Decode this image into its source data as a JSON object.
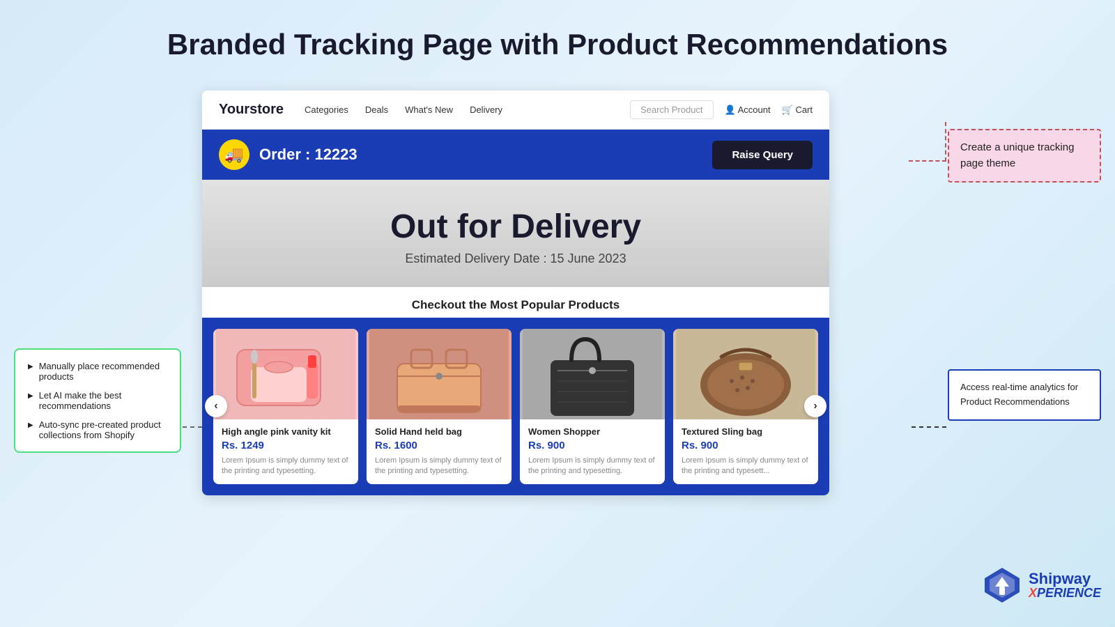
{
  "page": {
    "main_title": "Branded Tracking Page with Product Recommendations"
  },
  "store": {
    "logo": "Yourstore",
    "nav_links": [
      "Categories",
      "Deals",
      "What's New",
      "Delivery"
    ],
    "search_placeholder": "Search Product",
    "account_label": "Account",
    "cart_label": "Cart"
  },
  "order_banner": {
    "order_label": "Order : 12223",
    "raise_query_btn": "Raise Query",
    "delivery_icon": "🚚"
  },
  "delivery_status": {
    "title": "Out for Delivery",
    "estimated_date": "Estimated Delivery Date : 15 June 2023"
  },
  "products_section": {
    "heading": "Checkout the Most Popular Products",
    "products": [
      {
        "name": "High angle pink vanity kit",
        "price": "Rs. 1249",
        "description": "Lorem Ipsum is simply dummy text of the printing and typesetting.",
        "color": "pink"
      },
      {
        "name": "Solid Hand held bag",
        "price": "Rs. 1600",
        "description": "Lorem Ipsum is simply dummy text of the printing and typesetting.",
        "color": "salmon"
      },
      {
        "name": "Women Shopper",
        "price": "Rs. 900",
        "description": "Lorem Ipsum is simply dummy text of the printing and typesetting.",
        "color": "gray"
      },
      {
        "name": "Textured Sling bag",
        "price": "Rs. 900",
        "description": "Lorem Ipsum is simply dummy text of the printing and typesett...",
        "color": "beige"
      }
    ],
    "prev_btn": "‹",
    "next_btn": "›"
  },
  "left_annotation": {
    "items": [
      "Manually place recommended products",
      "Let AI make the best recommendations",
      "Auto-sync pre-created product collections from Shopify"
    ]
  },
  "right_annotation_top": {
    "text": "Create a unique tracking page theme"
  },
  "right_annotation_bottom": {
    "text": "Access real-time analytics for Product Recommendations"
  },
  "shipway_logo": {
    "name": "Shipway",
    "sub_x": "X",
    "sub_perience": "PERIENCE"
  }
}
